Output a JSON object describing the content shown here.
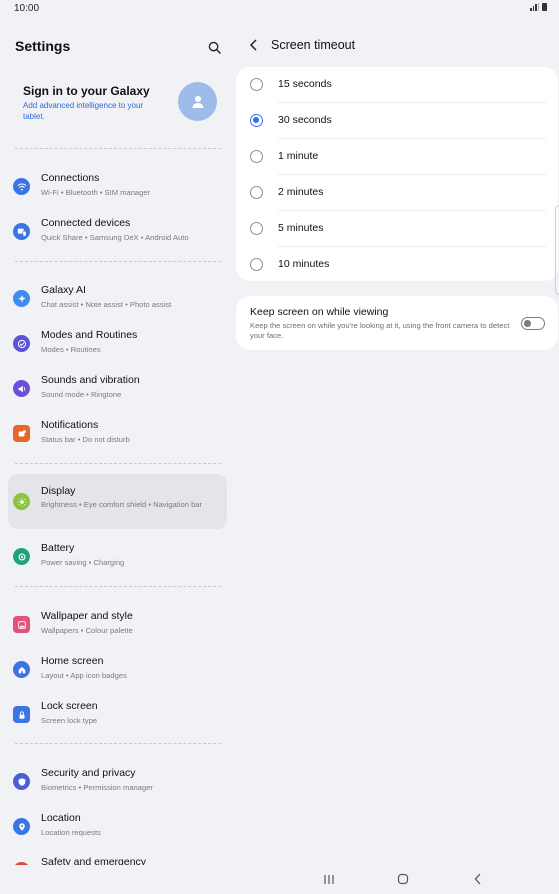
{
  "status": {
    "time": "10:00"
  },
  "left": {
    "title": "Settings",
    "account": {
      "title": "Sign in to your Galaxy",
      "subtitle": "Add advanced intelligence to your tablet."
    },
    "items": [
      {
        "title": "Connections",
        "subtitle": "Wi-Fi • Bluetooth • SIM manager",
        "icon": "wifi-icon",
        "color": "#3b74e3"
      },
      {
        "title": "Connected devices",
        "subtitle": "Quick Share • Samsung DeX • Android Auto",
        "icon": "devices-icon",
        "color": "#3b74e3"
      },
      {
        "title": "Galaxy AI",
        "subtitle": "Chat assist • Note assist • Photo assist",
        "icon": "ai-sparkle-icon",
        "color": "#3f8cf0"
      },
      {
        "title": "Modes and Routines",
        "subtitle": "Modes • Routines",
        "icon": "check-circle-icon",
        "color": "#5b54d8"
      },
      {
        "title": "Sounds and vibration",
        "subtitle": "Sound mode • Ringtone",
        "icon": "speaker-icon",
        "color": "#6c4fd8"
      },
      {
        "title": "Notifications",
        "subtitle": "Status bar • Do not disturb",
        "icon": "notification-icon",
        "color": "#e9662a"
      },
      {
        "title": "Display",
        "subtitle": "Brightness • Eye comfort shield • Navigation bar",
        "icon": "sun-icon",
        "color": "#8ac43c"
      },
      {
        "title": "Battery",
        "subtitle": "Power saving • Charging",
        "icon": "battery-icon",
        "color": "#1fa37e"
      },
      {
        "title": "Wallpaper and style",
        "subtitle": "Wallpapers • Colour palette",
        "icon": "wallpaper-icon",
        "color": "#e2527d"
      },
      {
        "title": "Home screen",
        "subtitle": "Layout • App icon badges",
        "icon": "home-icon",
        "color": "#3b74e3"
      },
      {
        "title": "Lock screen",
        "subtitle": "Screen lock type",
        "icon": "lock-icon",
        "color": "#3b74e3"
      },
      {
        "title": "Security and privacy",
        "subtitle": "Biometrics • Permission manager",
        "icon": "shield-icon",
        "color": "#4a5ed8"
      },
      {
        "title": "Location",
        "subtitle": "Location requests",
        "icon": "location-pin-icon",
        "color": "#3b74e3"
      },
      {
        "title": "Safety and emergency",
        "subtitle": "",
        "icon": "emergency-icon",
        "color": "#e5483f"
      }
    ]
  },
  "right": {
    "title": "Screen timeout",
    "options": [
      {
        "label": "15 seconds",
        "selected": false
      },
      {
        "label": "30 seconds",
        "selected": true
      },
      {
        "label": "1 minute",
        "selected": false
      },
      {
        "label": "2 minutes",
        "selected": false
      },
      {
        "label": "5 minutes",
        "selected": false
      },
      {
        "label": "10 minutes",
        "selected": false
      }
    ],
    "keep": {
      "title": "Keep screen on while viewing",
      "subtitle": "Keep the screen on while you're looking at it, using the front camera to detect your face.",
      "enabled": false
    }
  },
  "accent": "#3a6ee8"
}
